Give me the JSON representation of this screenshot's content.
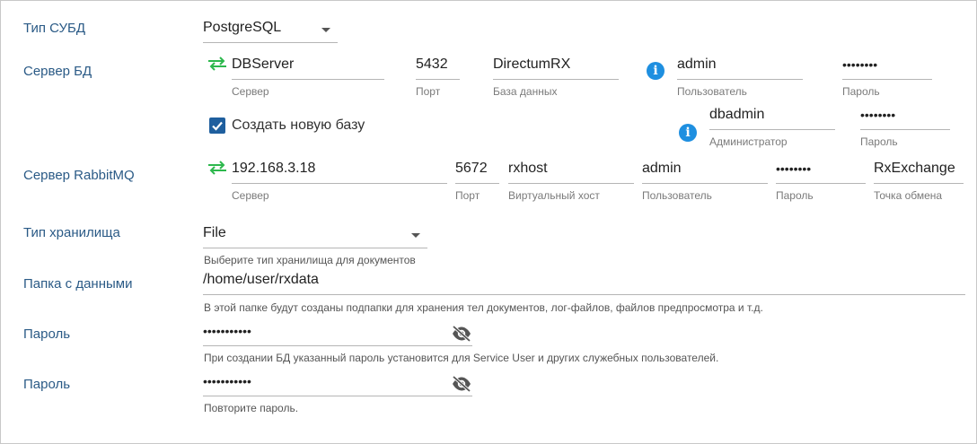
{
  "labels": {
    "dbms_type": "Тип СУБД",
    "db_server": "Сервер БД",
    "rabbitmq_server": "Сервер RabbitMQ",
    "storage_type": "Тип хранилища",
    "data_folder": "Папка с данными",
    "password1": "Пароль",
    "password2": "Пароль"
  },
  "dbms": {
    "value": "PostgreSQL"
  },
  "db": {
    "server": {
      "value": "DBServer",
      "caption": "Сервер"
    },
    "port": {
      "value": "5432",
      "caption": "Порт"
    },
    "database": {
      "value": "DirectumRX",
      "caption": "База данных"
    },
    "user": {
      "value": "admin",
      "caption": "Пользователь"
    },
    "password": {
      "value": "••••••••",
      "caption": "Пароль"
    },
    "create_new": {
      "label": "Создать новую базу",
      "checked": true
    },
    "admin": {
      "value": "dbadmin",
      "caption": "Администратор"
    },
    "admin_password": {
      "value": "••••••••",
      "caption": "Пароль"
    }
  },
  "rabbit": {
    "server": {
      "value": "192.168.3.18",
      "caption": "Сервер"
    },
    "port": {
      "value": "5672",
      "caption": "Порт"
    },
    "vhost": {
      "value": "rxhost",
      "caption": "Виртуальный хост"
    },
    "user": {
      "value": "admin",
      "caption": "Пользователь"
    },
    "password": {
      "value": "••••••••",
      "caption": "Пароль"
    },
    "exchange": {
      "value": "RxExchange",
      "caption": "Точка обмена"
    }
  },
  "storage": {
    "value": "File",
    "hint": "Выберите тип хранилища для документов"
  },
  "folder": {
    "value": "/home/user/rxdata",
    "hint": "В этой папке будут созданы подпапки для хранения тел документов, лог-файлов, файлов предпросмотра и т.д."
  },
  "pass1": {
    "value": "•••••••••••",
    "hint": "При создании БД указанный пароль установится для Service User и других служебных пользователей."
  },
  "pass2": {
    "value": "•••••••••••",
    "hint": "Повторите пароль."
  },
  "colors": {
    "label": "#2a5a86",
    "accent": "#1e8fe0",
    "swap": "#2db84d",
    "checkbox": "#1f5f9e"
  }
}
